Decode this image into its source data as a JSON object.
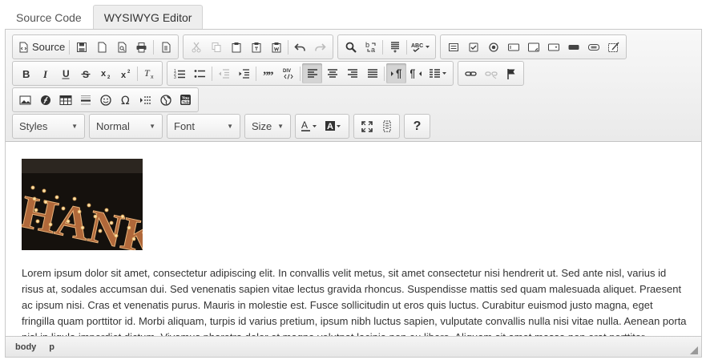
{
  "tabs": [
    {
      "label": "Source Code",
      "active": false
    },
    {
      "label": "WYSIWYG Editor",
      "active": true
    }
  ],
  "toolbar": {
    "source_label": "Source",
    "combos": {
      "styles": "Styles",
      "format": "Normal",
      "font": "Font",
      "size": "Size"
    },
    "help_label": "?"
  },
  "content": {
    "image_text": "HANK",
    "paragraph": "Lorem ipsum dolor sit amet, consectetur adipiscing elit. In convallis velit metus, sit amet consectetur nisi hendrerit ut. Sed ante nisl, varius id risus at, sodales accumsan dui. Sed venenatis sapien vitae lectus gravida rhoncus. Suspendisse mattis sed quam malesuada aliquet. Praesent ac ipsum nisi. Cras et venenatis purus. Mauris in molestie est. Fusce sollicitudin ut eros quis luctus. Curabitur euismod justo magna, eget fringilla quam porttitor id. Morbi aliquam, turpis id varius pretium, ipsum nibh luctus sapien, vulputate convallis nulla nisi vitae nulla. Aenean porta nisl in ligula imperdiet dictum. Vivamus pharetra dolor et magna volutpat lacinia non eu libero. Aliquam sit amet massa non erat porttitor"
  },
  "status": {
    "path": [
      "body",
      "p"
    ]
  },
  "colors": {
    "toolbar_bg": "#eaeaea",
    "border": "#c4c4c4",
    "active_button": "#d4d4d4",
    "text": "#333333"
  }
}
